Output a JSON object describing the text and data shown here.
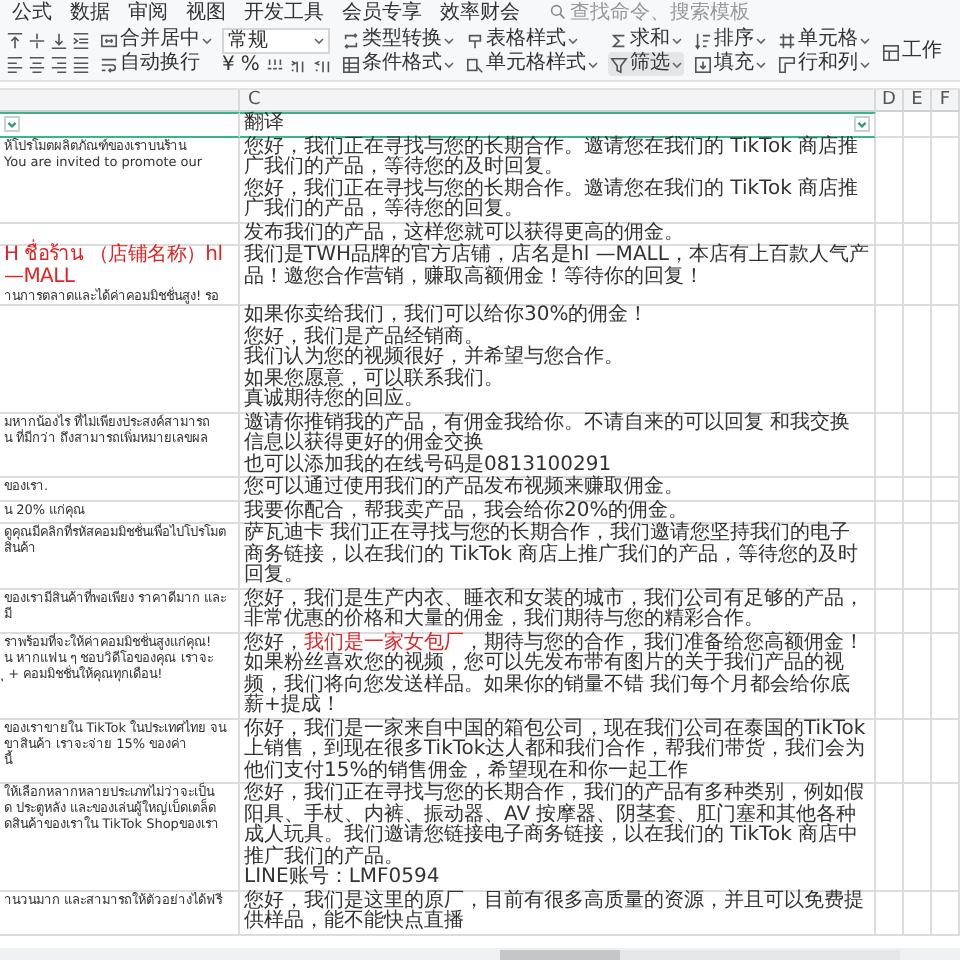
{
  "menu": [
    "公式",
    "数据",
    "审阅",
    "视图",
    "开发工具",
    "会员专享",
    "效率财会"
  ],
  "search": {
    "placeholder": "查找命令、搜索模板"
  },
  "toolbar": {
    "groups": [
      [
        {
          "kind": "button",
          "label": "合并居中",
          "dropdown": true,
          "selected": false
        },
        {
          "kind": "button",
          "label": "自动换行",
          "dropdown": false,
          "selected": false
        }
      ],
      [
        {
          "kind": "select",
          "value": "常规"
        },
        {
          "kind": "format",
          "symbols": [
            "¥",
            "%"
          ]
        }
      ],
      [
        {
          "kind": "button",
          "label": "类型转换",
          "dropdown": true,
          "selected": false
        },
        {
          "kind": "button",
          "label": "条件格式",
          "dropdown": true,
          "selected": false
        }
      ],
      [
        {
          "kind": "button",
          "label": "表格样式",
          "dropdown": true,
          "selected": false
        },
        {
          "kind": "button",
          "label": "单元格样式",
          "dropdown": true,
          "selected": false
        }
      ],
      [
        {
          "kind": "button",
          "label": "求和",
          "dropdown": true,
          "selected": false
        },
        {
          "kind": "button",
          "label": "筛选",
          "dropdown": true,
          "selected": true
        }
      ],
      [
        {
          "kind": "button",
          "label": "排序",
          "dropdown": true,
          "selected": false
        },
        {
          "kind": "button",
          "label": "填充",
          "dropdown": true,
          "selected": false
        }
      ],
      [
        {
          "kind": "button",
          "label": "单元格",
          "dropdown": true,
          "selected": false
        },
        {
          "kind": "button",
          "label": "行和列",
          "dropdown": true,
          "selected": false
        }
      ],
      [
        {
          "kind": "button",
          "label": "工作",
          "dropdown": false,
          "selected": false
        }
      ]
    ]
  },
  "table": {
    "columns": [
      "C",
      "D",
      "E",
      "F"
    ],
    "header_label": "翻译",
    "rows": [
      {
        "source": [
          {
            "text": "ห้โปรโมตผลิตภัณฑ์ของเราบนร้าน",
            "highlight": false
          },
          {
            "text": "You are invited to promote our",
            "highlight": false
          }
        ],
        "translation": [
          [
            {
              "text": "您好，我们正在寻找与您的长期合作。邀请您在我们的 TikTok 商店推广我们的产品，等待您的及时回复。",
              "highlight": false
            }
          ],
          [
            {
              "text": "您好，我们正在寻找与您的长期合作。邀请您在我们的 TikTok 商店推广我们的产品，等待您的回复。",
              "highlight": false
            }
          ]
        ]
      },
      {
        "translation": [
          [
            {
              "text": "发布我们的产品，这样您就可以获得更高的佣金。",
              "highlight": false
            }
          ]
        ]
      },
      {
        "source": [
          {
            "text": "H  ชื่อร้าน （店铺名称）hl —MALL",
            "highlight": true
          },
          {
            "text": "านการตลาดและได้ค่าคอมมิชชั่นสูง! รอ",
            "highlight": false
          }
        ],
        "translation": [
          [
            {
              "text": "我们是TWH品牌的官方店铺，店名是hl —MALL，本店有上百款人气产品！邀您合作营销，赚取高额佣金！等待你的回复！",
              "highlight": false
            }
          ]
        ]
      },
      {
        "translation": [
          [
            {
              "text": "如果你卖给我们，我们可以给你30%的佣金！",
              "highlight": false
            }
          ],
          [
            {
              "text": "您好，我们是产品经销商。",
              "highlight": false
            }
          ],
          [
            {
              "text": "我们认为您的视频很好，并希望与您合作。",
              "highlight": false
            }
          ],
          [
            {
              "text": "如果您愿意，可以联系我们。",
              "highlight": false
            }
          ],
          [
            {
              "text": "真诚期待您的回应。",
              "highlight": false
            }
          ]
        ]
      },
      {
        "source": [
          {
            "text": "มหากน้องไร ที่ไม่เพียงประสงค์สามารถ",
            "highlight": false
          },
          {
            "text": "น ที่มีกว่า ถึงสามารถเพิ่มหมายเลขผล",
            "highlight": false
          }
        ],
        "translation": [
          [
            {
              "text": "邀请你推销我的产品，有佣金我给你。不请自来的可以回复 和我交换信息以获得更好的佣金交换",
              "highlight": false
            }
          ],
          [
            {
              "text": "也可以添加我的在线号码是0813100291",
              "highlight": false
            }
          ]
        ]
      },
      {
        "source": [
          {
            "text": "ของเรา.",
            "highlight": false
          }
        ],
        "translation": [
          [
            {
              "text": "您可以通过使用我们的产品发布视频来赚取佣金。",
              "highlight": false
            }
          ]
        ]
      },
      {
        "source": [
          {
            "text": "น 20% แก่คุณ",
            "highlight": false
          }
        ],
        "translation": [
          [
            {
              "text": "我要你配合，帮我卖产品，我会给你20%的佣金。",
              "highlight": false
            }
          ]
        ]
      },
      {
        "source": [
          {
            "text": "ดูคุณมีคลิกที่รหัสคอมมิชชั่นเพื่อไปโปรโมตสินค้า",
            "highlight": false
          }
        ],
        "translation": [
          [
            {
              "text": "萨瓦迪卡 我们正在寻找与您的长期合作，我们邀请您坚持我们的电子商务链接，以在我们的 TikTok 商店上推广我们的产品，等待您的及时回复。",
              "highlight": false
            }
          ]
        ]
      },
      {
        "source": [
          {
            "text": "ของเรามีสินค้าที่พอเพียง ราคาดีมาก และมี",
            "highlight": false
          }
        ],
        "translation": [
          [
            {
              "text": "您好，我们是生产内衣、睡衣和女装的城市，我们公司有足够的产品，非常优惠的价格和大量的佣金，我们期待与您的精彩合作。",
              "highlight": false
            }
          ]
        ]
      },
      {
        "source": [
          {
            "text": "ราพร้อมที่จะให้ค่าคอมมิชชั่นสูงแก่คุณ!",
            "highlight": false
          },
          {
            "text": "น หากแฟน ๆ ชอบวิดีโอของคุณ เราจะ",
            "highlight": false
          },
          {
            "text": "ุ + คอมมิชชั่นให้คุณทุกเดือน!",
            "highlight": false
          }
        ],
        "translation": [
          [
            {
              "text": "您好，",
              "highlight": false
            },
            {
              "text": "我们是一家女包厂",
              "highlight": true
            },
            {
              "text": "，期待与您的合作，我们准备给您高额佣金！如果粉丝喜欢您的视频，您可以先发布带有图片的关于我们产品的视频，我们将向您发送样品。如果你的销量不错 我们每个月都会给你底薪+提成！",
              "highlight": false
            }
          ]
        ]
      },
      {
        "source": [
          {
            "text": "ของเราขายใน TikTok ในประเทศไทย จน",
            "highlight": false
          },
          {
            "text": "ขาสินค้า เราจะจ่าย 15% ของค่า",
            "highlight": false
          },
          {
            "text": "นี้",
            "highlight": false
          }
        ],
        "translation": [
          [
            {
              "text": "你好，我们是一家来自中国的箱包公司，现在我们公司在泰国的TikTok上销售，到现在很多TikTok达人都和我们合作，帮我们带货，我们会为他们支付15%的销售佣金，希望现在和你一起工作",
              "highlight": false
            }
          ]
        ]
      },
      {
        "source": [
          {
            "text": "ให้เลือกหลากหลายประเภทไม่ว่าจะเป็น",
            "highlight": false
          },
          {
            "text": "ด ประตูหลัง และของเล่นผู้ใหญ่เบ็ดเตล็ด",
            "highlight": false
          },
          {
            "text": "ดสินค้าของเราใน TikTok Shopของเรา",
            "highlight": false
          }
        ],
        "translation": [
          [
            {
              "text": "您好，我们正在寻找与您的长期合作，我们的产品有多种类别，例如假阳具、手杖、内裤、振动器、AV 按摩器、阴茎套、肛门塞和其他各种成人玩具。我们邀请您链接电子商务链接，以在我们的 TikTok 商店中推广我们的产品。",
              "highlight": false
            }
          ],
          [
            {
              "text": "LINE账号：LMF0594",
              "highlight": false
            }
          ]
        ]
      },
      {
        "source": [
          {
            "text": "านวนมาก และสามารถให้ตัวอย่างได้ฟรี",
            "highlight": false
          }
        ],
        "translation": [
          [
            {
              "text": "您好，我们是这里的原厂，目前有很多高质量的资源，并且可以免费提供样品，能不能快点直播",
              "highlight": false
            }
          ]
        ]
      }
    ]
  }
}
